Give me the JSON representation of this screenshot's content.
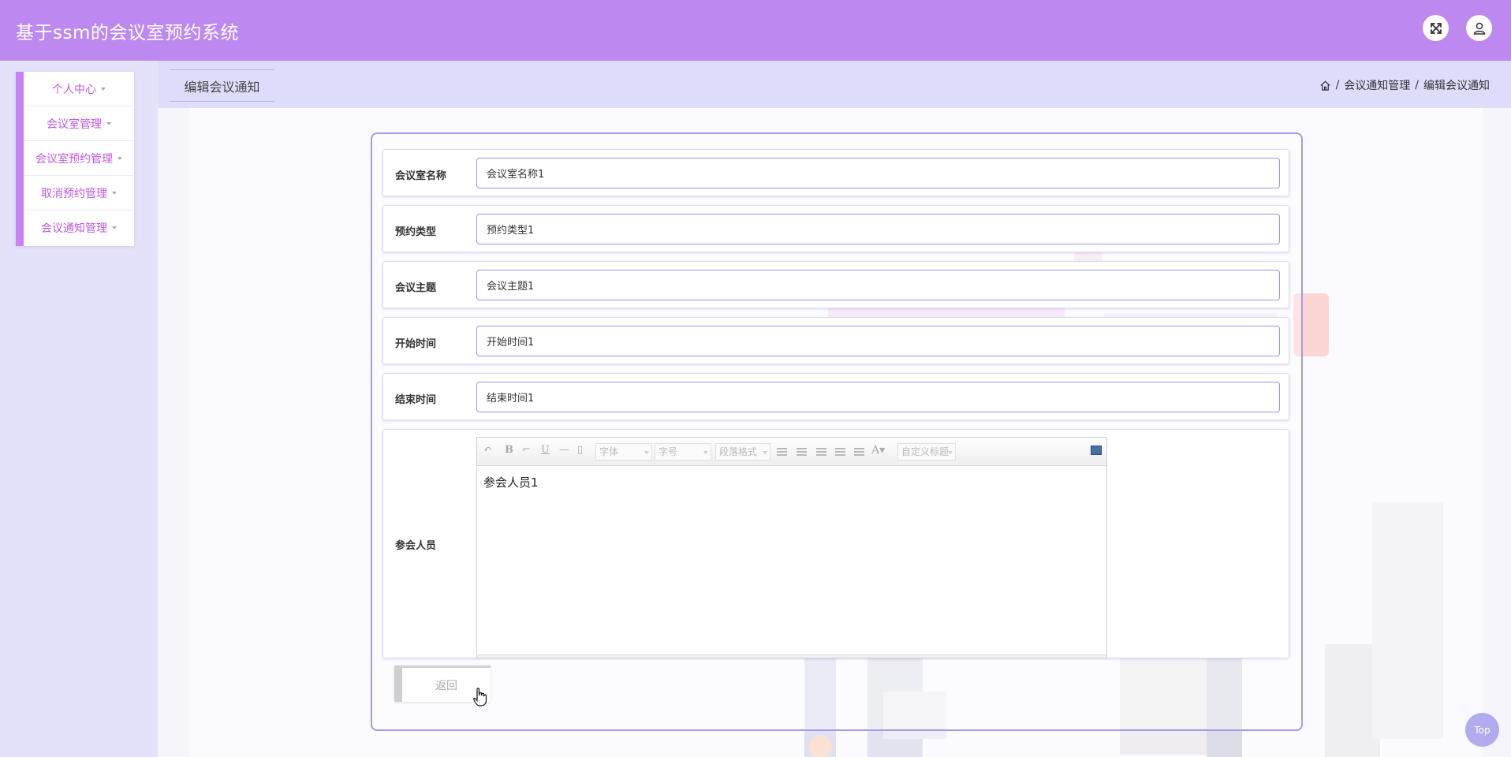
{
  "header": {
    "title": "基于ssm的会议室预约系统",
    "fullscreen_icon": "fullscreen-icon",
    "user_icon": "user-icon"
  },
  "sidebar": {
    "items": [
      {
        "label": "个人中心"
      },
      {
        "label": "会议室管理"
      },
      {
        "label": "会议室预约管理"
      },
      {
        "label": "取消预约管理"
      },
      {
        "label": "会议通知管理"
      }
    ]
  },
  "tab": {
    "label": "编辑会议通知"
  },
  "breadcrumb": {
    "home_icon": "home-icon",
    "separator": "/",
    "items": [
      "会议通知管理",
      "编辑会议通知"
    ]
  },
  "form": {
    "fields": [
      {
        "label": "会议室名称",
        "value": "会议室名称1"
      },
      {
        "label": "预约类型",
        "value": "预约类型1"
      },
      {
        "label": "会议主题",
        "value": "会议主题1"
      },
      {
        "label": "开始时间",
        "value": "开始时间1"
      },
      {
        "label": "结束时间",
        "value": "结束时间1"
      }
    ],
    "participants": {
      "label": "参会人员",
      "content": "参会人员1",
      "toolbar": {
        "font_family": "字体",
        "font_size": "字号",
        "paragraph": "段落格式",
        "custom_title": "自定义标题"
      }
    },
    "back_label": "返回"
  },
  "top_button": {
    "label": "Top"
  },
  "colors": {
    "header": "#bd89f0",
    "sidebar_accent": "#c882f3",
    "sidebar_text": "#c058e0",
    "panel_border": "#a29be6",
    "background": "#e4e2fb"
  }
}
